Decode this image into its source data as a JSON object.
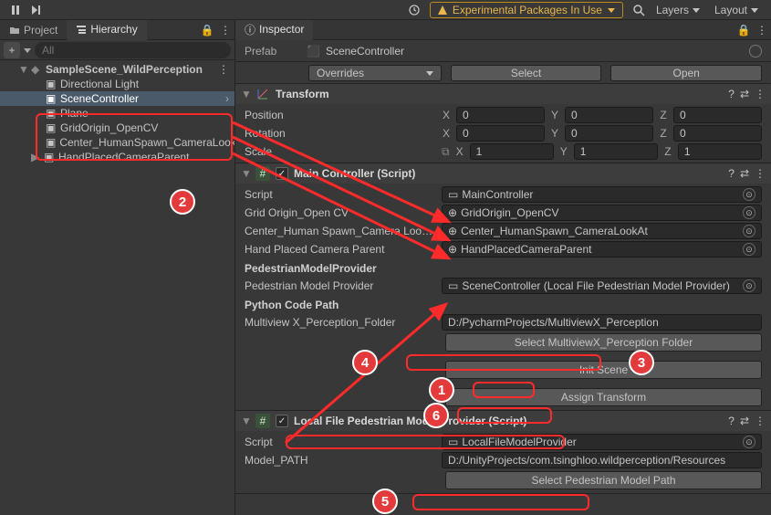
{
  "topbar": {
    "warning": "Experimental Packages In Use",
    "layers": "Layers",
    "layout": "Layout"
  },
  "left": {
    "tabs": {
      "project": "Project",
      "hierarchy": "Hierarchy"
    },
    "search_placeholder": "All",
    "scene": "SampleScene_WildPerception",
    "items": [
      "Directional Light",
      "SceneController",
      "Plane",
      "GridOrigin_OpenCV",
      "Center_HumanSpawn_CameraLookAt",
      "HandPlacedCameraParent"
    ]
  },
  "inspector": {
    "tab": "Inspector",
    "prefab_lbl": "Prefab",
    "prefab_name": "SceneController",
    "overrides": "Overrides",
    "select": "Select",
    "open": "Open",
    "transform": {
      "title": "Transform",
      "pos": "Position",
      "rot": "Rotation",
      "scl": "Scale",
      "x": "X",
      "y": "Y",
      "z": "Z",
      "pv": [
        "0",
        "0",
        "0"
      ],
      "rv": [
        "0",
        "0",
        "0"
      ],
      "sv": [
        "1",
        "1",
        "1"
      ]
    },
    "main": {
      "title": "Main Controller (Script)",
      "script_lbl": "Script",
      "script_val": "MainController",
      "grid_lbl": "Grid Origin_Open CV",
      "grid_val": "GridOrigin_OpenCV",
      "center_lbl": "Center_Human Spawn_Camera Look At",
      "center_val": "Center_HumanSpawn_CameraLookAt",
      "hand_lbl": "Hand Placed Camera Parent",
      "hand_val": "HandPlacedCameraParent",
      "pmp_head": "PedestrianModelProvider",
      "pmp_lbl": "Pedestrian Model Provider",
      "pmp_val": "SceneController (Local File Pedestrian Model Provider)",
      "pcp_head": "Python Code Path",
      "pcp_lbl": "Multiview X_Perception_Folder",
      "pcp_val": "D:/PycharmProjects/MultiviewX_Perception",
      "btn_select_folder": "Select MultiviewX_Perception Folder",
      "btn_init": "Init Scene",
      "btn_assign": "Assign Transform"
    },
    "local": {
      "title": "Local File Pedestrian Model Provider (Script)",
      "script_lbl": "Script",
      "script_val": "LocalFileModelProvider",
      "model_lbl": "Model_PATH",
      "model_val": "D:/UnityProjects/com.tsinghloo.wildperception/Resources",
      "btn_select_model": "Select Pedestrian Model Path"
    }
  }
}
